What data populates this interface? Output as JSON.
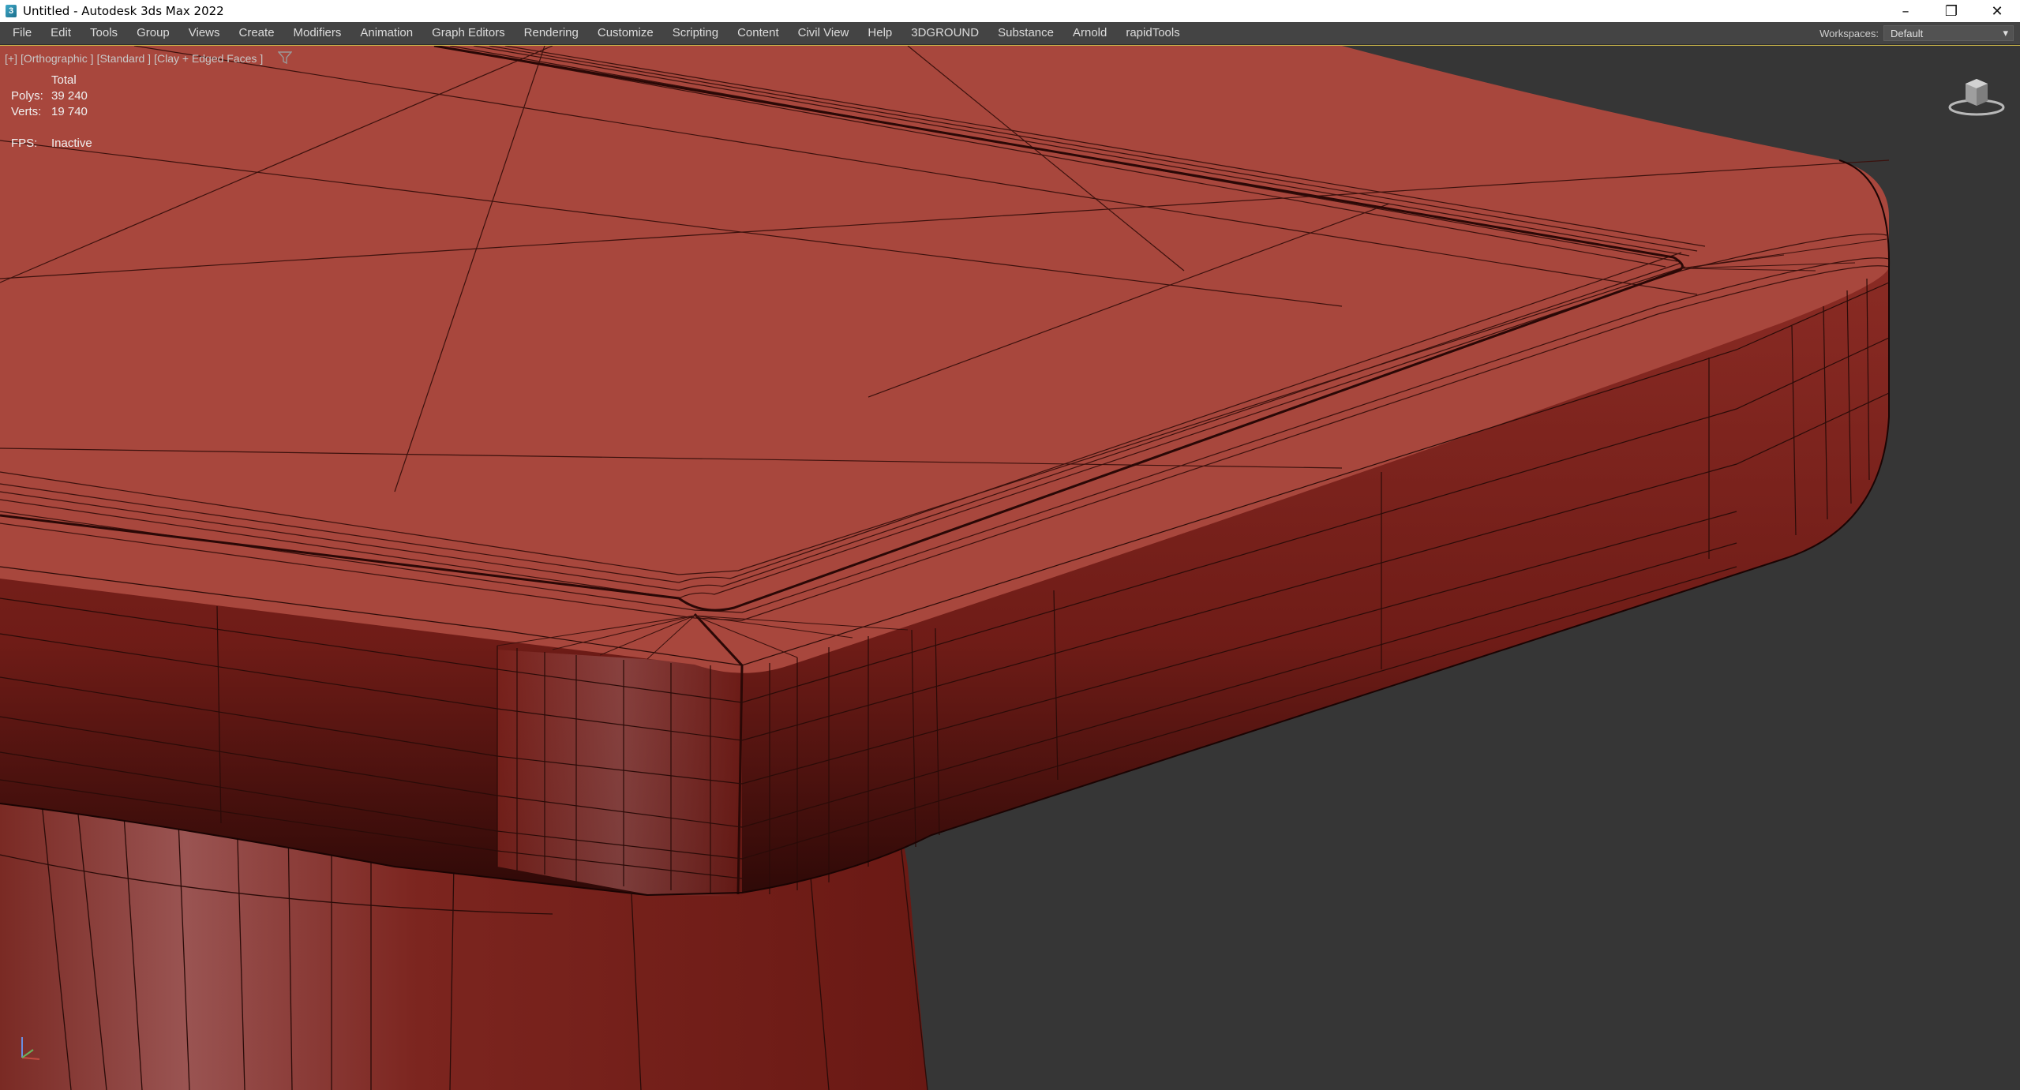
{
  "window": {
    "title": "Untitled - Autodesk 3ds Max 2022",
    "app_icon_glyph": "3",
    "controls": {
      "minimize": "–",
      "restore": "❐",
      "close": "✕"
    }
  },
  "menubar": {
    "items": [
      "File",
      "Edit",
      "Tools",
      "Group",
      "Views",
      "Create",
      "Modifiers",
      "Animation",
      "Graph Editors",
      "Rendering",
      "Customize",
      "Scripting",
      "Content",
      "Civil View",
      "Help",
      "3DGROUND",
      "Substance",
      "Arnold",
      "rapidTools"
    ],
    "workspace_label": "Workspaces:",
    "workspace_value": "Default"
  },
  "viewport": {
    "label_parts": [
      "[+]",
      "[Orthographic ]",
      "[Standard ]",
      "[Clay + Edged Faces ]"
    ],
    "stats": {
      "header": "Total",
      "polys_label": "Polys:",
      "polys_value": "39 240",
      "verts_label": "Verts:",
      "verts_value": "19 740",
      "fps_label": "FPS:",
      "fps_value": "Inactive"
    },
    "icons": [
      "filter-icon",
      "viewcube-icon",
      "axis-tripod-icon"
    ],
    "colors": {
      "background": "#363636",
      "clay_top": "#a8473d",
      "clay_side": "#761d18",
      "edge": "#2a0b08",
      "active_border": "#cbb64a"
    }
  }
}
